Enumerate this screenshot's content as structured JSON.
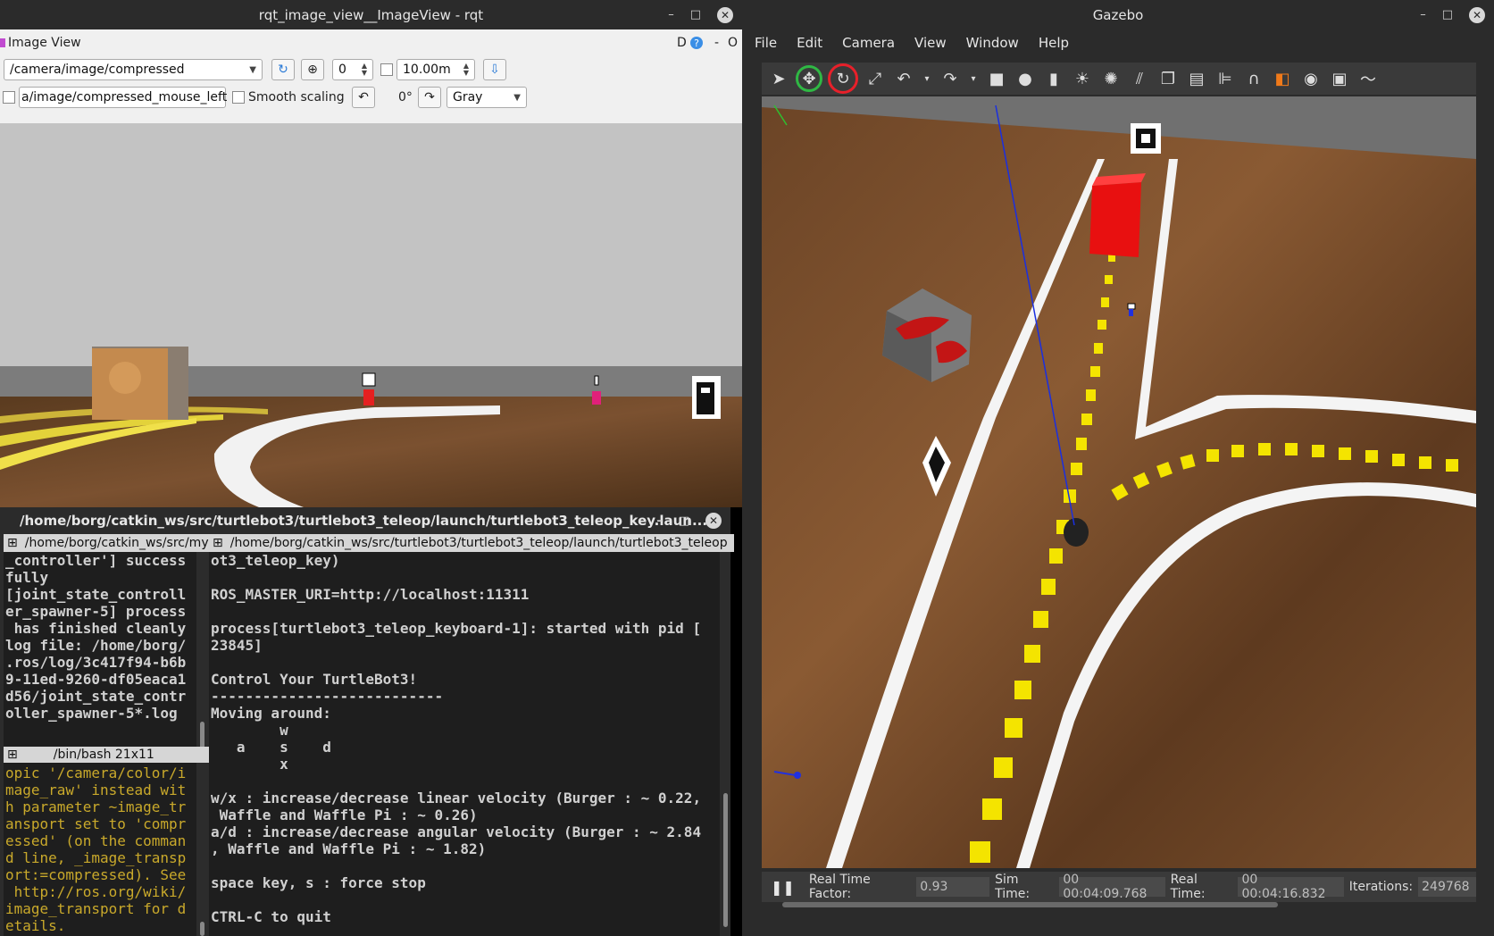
{
  "rqt": {
    "window_title": "rqt_image_view__ImageView - rqt",
    "panel_title": "Image View",
    "panel_right": "D",
    "panel_right2": "O",
    "topic": "/camera/image/compressed",
    "spin_value": "0",
    "distance": "10.00m",
    "mouse_topic": "a/image/compressed_mouse_left",
    "smooth_label": "Smooth scaling",
    "rotation": "0°",
    "color_scheme": "Gray",
    "btn_min": "–",
    "btn_max": "□",
    "btn_close": "✕"
  },
  "terminal": {
    "window_title": "/home/borg/catkin_ws/src/turtlebot3/turtlebot3_teleop/launch/turtlebot3_teleop_key.laun...",
    "tab_left": "/home/borg/catkin_ws/src/my",
    "tab_right": "/home/borg/catkin_ws/src/turtlebot3/turtlebot3_teleop/launch/turtlebot3_teleop",
    "left_top_lines": [
      "_controller'] success",
      "fully",
      "[joint_state_controll",
      "er_spawner-5] process",
      " has finished cleanly",
      "log file: /home/borg/",
      ".ros/log/3c417f94-b6b",
      "9-11ed-9260-df05eaca1",
      "d56/joint_state_contr",
      "oller_spawner-5*.log"
    ],
    "left_bottom_title": "/bin/bash 21x11",
    "left_bottom_lines": [
      "opic '/camera/color/i",
      "mage_raw' instead wit",
      "h parameter ~image_tr",
      "ansport set to 'compr",
      "essed' (on the comman",
      "d line, _image_transp",
      "ort:=compressed). See",
      " http://ros.org/wiki/",
      "image_transport for d",
      "etails."
    ],
    "right_lines": [
      "ot3_teleop_key)",
      "",
      "ROS_MASTER_URI=http://localhost:11311",
      "",
      "process[turtlebot3_teleop_keyboard-1]: started with pid [",
      "23845]",
      "",
      "Control Your TurtleBot3!",
      "---------------------------",
      "Moving around:",
      "        w",
      "   a    s    d",
      "        x",
      "",
      "w/x : increase/decrease linear velocity (Burger : ~ 0.22,",
      " Waffle and Waffle Pi : ~ 0.26)",
      "a/d : increase/decrease angular velocity (Burger : ~ 2.84",
      ", Waffle and Waffle Pi : ~ 1.82)",
      "",
      "space key, s : force stop",
      "",
      "CTRL-C to quit"
    ],
    "btn_min": "–",
    "btn_max": "□",
    "btn_close": "✕"
  },
  "gazebo": {
    "window_title": "Gazebo",
    "menu": [
      "File",
      "Edit",
      "Camera",
      "View",
      "Window",
      "Help"
    ],
    "status": {
      "rtf_label": "Real Time Factor:",
      "rtf_value": "0.93",
      "sim_label": "Sim Time:",
      "sim_value": "00 00:04:09.768",
      "real_label": "Real Time:",
      "real_value": "00 00:04:16.832",
      "iter_label": "Iterations:",
      "iter_value": "249768"
    },
    "btn_min": "–",
    "btn_max": "□",
    "btn_close": "✕"
  },
  "colors": {
    "terminal_yellow": "#c9a92b",
    "terminal_text": "#d0d0d0",
    "highlight_green": "#2fb844",
    "highlight_red": "#e8202a"
  }
}
